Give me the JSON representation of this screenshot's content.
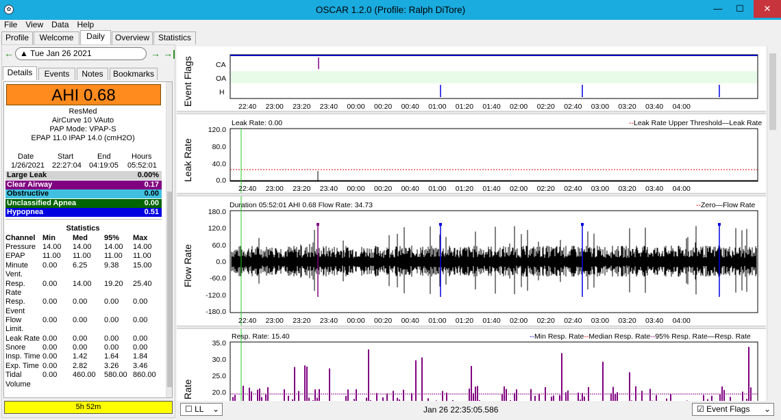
{
  "window": {
    "title": "OSCAR 1.2.0 (Profile: Ralph DiTore)"
  },
  "menu": [
    "File",
    "View",
    "Data",
    "Help"
  ],
  "tabs": [
    "Profile",
    "Welcome",
    "Daily",
    "Overview",
    "Statistics"
  ],
  "active_tab": "Daily",
  "nav": {
    "date": "Tue Jan 26 2021"
  },
  "subtabs": [
    "Details",
    "Events",
    "Notes",
    "Bookmarks"
  ],
  "ahi_label": "AHI 0.68",
  "machine": {
    "brand": "ResMed",
    "model": "AirCurve 10 VAuto",
    "mode": "PAP Mode: VPAP-S",
    "pressure": "EPAP 11.0 IPAP 14.0 (cmH2O)"
  },
  "session": {
    "headers": [
      "Date",
      "Start",
      "End",
      "Hours"
    ],
    "values": [
      "1/26/2021",
      "22:27:04",
      "04:19:05",
      "05:52:01"
    ]
  },
  "events": [
    {
      "name": "Large Leak",
      "value": "0.00%",
      "color": "#d3d3d3",
      "text": "#000000"
    },
    {
      "name": "Clear Airway",
      "value": "0.17",
      "color": "#800080",
      "text": "#ffffff"
    },
    {
      "name": "Obstructive",
      "value": "0.00",
      "color": "#40c0e0",
      "text": "#000000"
    },
    {
      "name": "Unclassified Apnea",
      "value": "0.00",
      "color": "#006400",
      "text": "#ffffff"
    },
    {
      "name": "Hypopnea",
      "value": "0.51",
      "color": "#0000e0",
      "text": "#ffffff"
    }
  ],
  "statistics": {
    "title": "Statistics",
    "headers": [
      "Channel",
      "Min",
      "Med",
      "95%",
      "Max"
    ],
    "rows": [
      [
        "Pressure",
        "14.00",
        "14.00",
        "14.00",
        "14.00"
      ],
      [
        "EPAP",
        "11.00",
        "11.00",
        "11.00",
        "11.00"
      ],
      [
        "Minute Vent.",
        "0.00",
        "6.25",
        "9.38",
        "15.00"
      ],
      [
        "Resp. Rate",
        "0.00",
        "14.00",
        "19.20",
        "25.40"
      ],
      [
        "Resp. Event",
        "0.00",
        "0.00",
        "0.00",
        "0.00"
      ],
      [
        "Flow Limit.",
        "0.00",
        "0.00",
        "0.00",
        "0.00"
      ],
      [
        "Leak Rate",
        "0.00",
        "0.00",
        "0.00",
        "0.00"
      ],
      [
        "Snore",
        "0.00",
        "0.00",
        "0.00",
        "0.00"
      ],
      [
        "Insp. Time",
        "0.00",
        "1.42",
        "1.64",
        "1.84"
      ],
      [
        "Exp. Time",
        "0.00",
        "2.82",
        "3.26",
        "3.46"
      ],
      [
        "Tidal Volume",
        "0.00",
        "460.00",
        "580.00",
        "860.00"
      ]
    ]
  },
  "duration_bar": "5h 52m",
  "time_ticks": [
    "22:40",
    "23:00",
    "23:20",
    "23:40",
    "00:00",
    "00:20",
    "00:40",
    "01:00",
    "01:20",
    "01:40",
    "02:00",
    "02:20",
    "02:40",
    "03:00",
    "03:20",
    "03:40",
    "04:00"
  ],
  "graphs": {
    "event_flags": {
      "label": "Event Flags",
      "rows": [
        "CA",
        "OA",
        "H"
      ]
    },
    "leak": {
      "label": "Leak Rate",
      "caption": "Leak Rate: 0.00",
      "legend": [
        "Leak Rate Upper Threshold",
        "Leak Rate"
      ],
      "yticks": [
        "120.0",
        "80.0",
        "40.0",
        "0.0"
      ]
    },
    "flow": {
      "label": "Flow Rate",
      "caption": "Duration 05:52:01 AHI 0.68 Flow Rate: 34.73",
      "legend": [
        "Zero",
        "Flow Rate"
      ],
      "yticks": [
        "180.0",
        "120.0",
        "60.0",
        "0.0",
        "-60.0",
        "-120.0",
        "-180.0"
      ]
    },
    "resp": {
      "label": "Rate",
      "caption": "Resp. Rate: 15.40",
      "legend": [
        "Min Resp. Rate",
        "Median Resp. Rate",
        "95% Resp. Rate",
        "Resp. Rate"
      ],
      "yticks": [
        "35.0",
        "30.0",
        "25.0",
        "20.0"
      ]
    }
  },
  "bottom": {
    "layout": "LL",
    "timestamp": "Jan 26 22:35:05.586",
    "event_flags": "Event Flags"
  }
}
